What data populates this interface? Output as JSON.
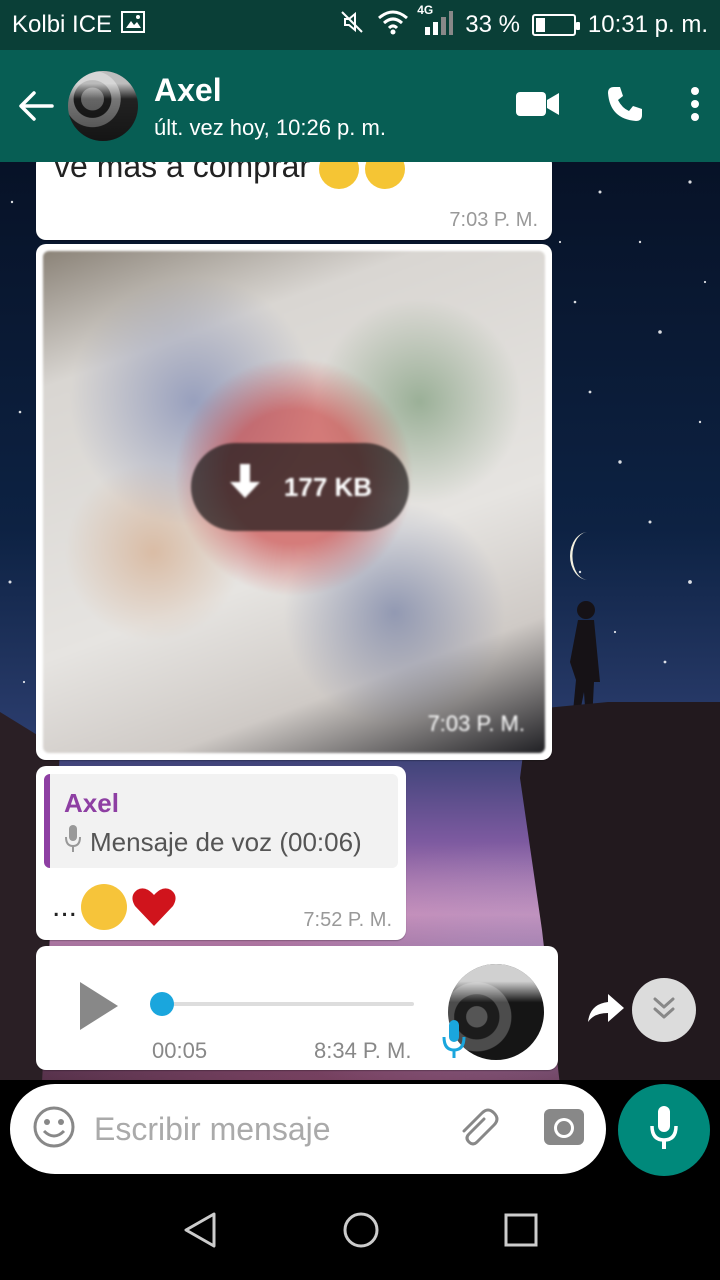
{
  "status_bar": {
    "carrier": "Kolbi ICE",
    "network": "4G",
    "battery": "33 %",
    "battery_level": 0.33,
    "time": "10:31 p. m."
  },
  "header": {
    "contact_name": "Axel",
    "last_seen": "últ. vez hoy, 10:26 p. m."
  },
  "messages": {
    "text_partial": "ve más a comprar",
    "text_partial_time": "7:03 P. M.",
    "image_size": "177 KB",
    "image_time": "7:03 P. M.",
    "reply_quote_name": "Axel",
    "reply_quote_text": "Mensaje de voz (00:06)",
    "reply_text": "...",
    "reply_time": "7:52 P. M.",
    "voice_duration": "00:05",
    "voice_time": "8:34 P. M."
  },
  "input": {
    "placeholder": "Escribir mensaje"
  },
  "colors": {
    "header": "#075e54",
    "accent": "#00897b",
    "quote": "#8e3fa3",
    "voice_knob": "#1aa6dd"
  }
}
